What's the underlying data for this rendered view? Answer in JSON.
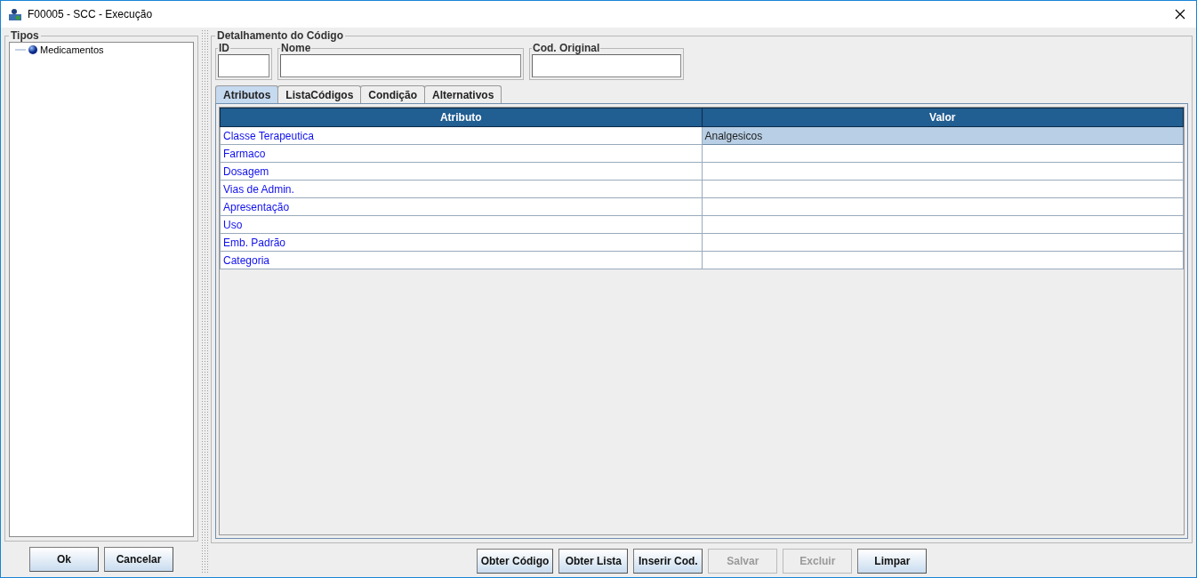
{
  "window": {
    "title": "F00005 - SCC - Execução"
  },
  "tipos": {
    "title": "Tipos",
    "tree": [
      {
        "label": "Medicamentos"
      }
    ],
    "buttons": [
      {
        "label": "Ok",
        "disabled": false
      },
      {
        "label": "Cancelar",
        "disabled": false
      }
    ]
  },
  "detalhe": {
    "title": "Detalhamento do Código",
    "fields": [
      {
        "label": "ID"
      },
      {
        "label": "Nome"
      },
      {
        "label": "Cod. Original"
      }
    ]
  },
  "tabs": [
    {
      "label": "Atributos",
      "selected": true
    },
    {
      "label": "ListaCódigos",
      "selected": false
    },
    {
      "label": "Condição",
      "selected": false
    },
    {
      "label": "Alternativos",
      "selected": false
    }
  ],
  "table": {
    "columns": [
      "Atributo",
      "Valor"
    ],
    "rows": [
      {
        "atributo": "Classe Terapeutica",
        "valor": "Analgesicos",
        "selected": true
      },
      {
        "atributo": "Farmaco",
        "selected": false
      },
      {
        "atributo": "Dosagem",
        "selected": false
      },
      {
        "atributo": "Vias de Admin.",
        "selected": false
      },
      {
        "atributo": "Apresentação",
        "selected": false
      },
      {
        "atributo": "Uso",
        "selected": false
      },
      {
        "atributo": "Emb. Padrão",
        "selected": false
      },
      {
        "atributo": "Categoria",
        "selected": false
      }
    ]
  },
  "buttons": [
    {
      "label": "Obter Código",
      "disabled": false
    },
    {
      "label": "Obter Lista",
      "disabled": false
    },
    {
      "label": "Inserir Cod.",
      "disabled": false
    },
    {
      "label": "Salvar",
      "disabled": true
    },
    {
      "label": "Excluir",
      "disabled": true
    },
    {
      "label": "Limpar",
      "disabled": false
    }
  ]
}
